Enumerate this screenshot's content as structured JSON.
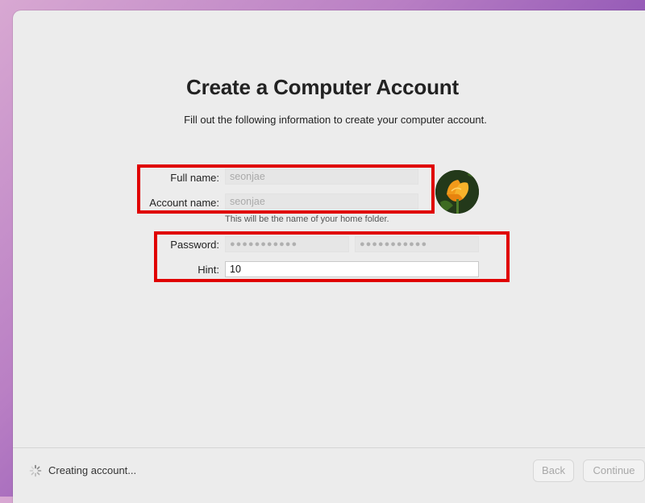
{
  "page": {
    "title": "Create a Computer Account",
    "subtitle": "Fill out the following information to create your computer account."
  },
  "form": {
    "full_name": {
      "label": "Full name:",
      "value": "seonjae"
    },
    "account_name": {
      "label": "Account name:",
      "value": "seonjae",
      "note": "This will be the name of your home folder."
    },
    "password": {
      "label": "Password:",
      "value": "●●●●●●●●●●●",
      "verify_value": "●●●●●●●●●●●"
    },
    "hint": {
      "label": "Hint:",
      "value": "10"
    }
  },
  "avatar": {
    "icon": "orange-poppy-flower-photo"
  },
  "footer": {
    "status": "Creating account...",
    "back_label": "Back",
    "continue_label": "Continue"
  },
  "colors": {
    "highlight_box": "#e00000",
    "window_bg": "#ececec"
  }
}
